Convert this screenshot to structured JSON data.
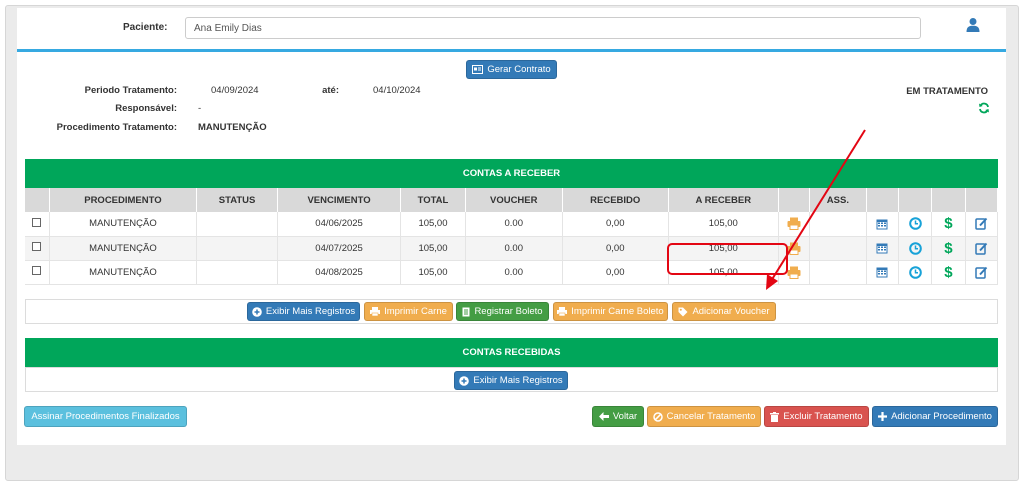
{
  "patient": {
    "label": "Paciente:",
    "value": "Ana Emily Dias"
  },
  "contract_button": "Gerar Contrato",
  "treatment": {
    "period_label": "Periodo Tratamento:",
    "period_start": "04/09/2024",
    "until_label": "até:",
    "period_end": "04/10/2024",
    "responsible_label": "Responsável:",
    "responsible_value": "-",
    "procedure_label": "Procedimento Tratamento:",
    "procedure_value": "MANUTENÇÃO",
    "status": "EM TRATAMENTO"
  },
  "receivables": {
    "title": "CONTAS A RECEBER",
    "columns": [
      "PROCEDIMENTO",
      "STATUS",
      "VENCIMENTO",
      "TOTAL",
      "VOUCHER",
      "RECEBIDO",
      "A RECEBER",
      "ASS."
    ],
    "rows": [
      {
        "procedure": "MANUTENÇÃO",
        "status": "",
        "due": "04/06/2025",
        "total": "105,00",
        "voucher": "0.00",
        "received": "0,00",
        "to_receive": "105,00"
      },
      {
        "procedure": "MANUTENÇÃO",
        "status": "",
        "due": "04/07/2025",
        "total": "105,00",
        "voucher": "0.00",
        "received": "0,00",
        "to_receive": "105,00"
      },
      {
        "procedure": "MANUTENÇÃO",
        "status": "",
        "due": "04/08/2025",
        "total": "105,00",
        "voucher": "0.00",
        "received": "0,00",
        "to_receive": "105,00"
      }
    ],
    "buttons": {
      "show_more": "Exibir Mais Registros",
      "print_carne": "Imprimir Carne",
      "register_boleto": "Registrar Boleto",
      "print_carne_boleto": "Imprimir Carne Boleto",
      "add_voucher": "Adicionar Voucher"
    }
  },
  "received": {
    "title": "CONTAS RECEBIDAS",
    "show_more": "Exibir Mais Registros"
  },
  "footer": {
    "sign_finished": "Assinar Procedimentos Finalizados",
    "back": "Voltar",
    "cancel_treatment": "Cancelar Tratamento",
    "delete_treatment": "Excluir Tratamento",
    "add_procedure": "Adicionar Procedimento"
  },
  "icons": {
    "user": "user-icon",
    "refresh": "refresh-icon",
    "printer": "printer-icon",
    "calendar": "calendar-icon",
    "clock": "clock-icon",
    "dollar": "dollar-icon",
    "edit": "edit-icon",
    "tag": "tag-icon",
    "plus_circle": "plus-circle-icon",
    "arrow_left": "arrow-left-icon",
    "ban": "ban-icon",
    "trash": "trash-icon",
    "plus": "plus-icon",
    "contract": "contract-icon",
    "annotation_arrow": "annotation-arrow"
  },
  "colors": {
    "section_green": "#00a65a",
    "primary_blue": "#337ab7",
    "warning_orange": "#f0ad4e",
    "success_green": "#449d44",
    "danger_red": "#d9534f",
    "info_cyan": "#5bc0de",
    "annotation_red": "#e30613"
  }
}
